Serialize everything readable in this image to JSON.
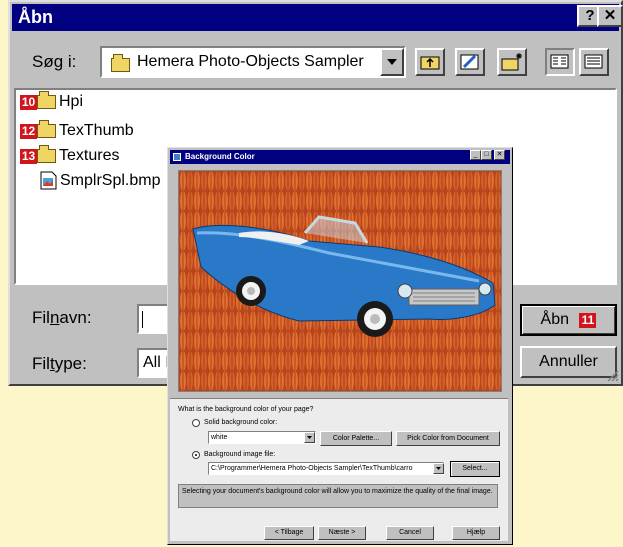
{
  "open_dialog": {
    "title": "Åbn",
    "title_buttons": {
      "help": "?",
      "close": "✕"
    },
    "look_in": {
      "label": "Søg i:",
      "value": "Hemera Photo-Objects Sampler"
    },
    "files": [
      {
        "badge": "10",
        "name": "Hpi",
        "type": "folder"
      },
      {
        "badge": "12",
        "name": "TexThumb",
        "type": "folder"
      },
      {
        "badge": "13",
        "name": "Textures",
        "type": "folder"
      },
      {
        "badge": "",
        "name": "SmplrSpl.bmp",
        "type": "bitmap"
      }
    ],
    "filename": {
      "label": "Filnavn:",
      "value": ""
    },
    "filetype": {
      "label": "Filtype:",
      "value": "All I"
    },
    "open_button": {
      "label": "Åbn",
      "badge": "11"
    },
    "cancel_button": "Annuller"
  },
  "bg_dialog": {
    "title": "Background Color",
    "question": "What is the background color of your page?",
    "solid": {
      "label": "Solid background color:",
      "value": "white",
      "palette_button": "Color Palette...",
      "pick_button": "Pick Color from Document"
    },
    "image": {
      "label": "Background image file:",
      "value": "C:\\Programmer\\Hemera Photo-Objects Sampler\\TexThumb\\carro",
      "select_button": "Select..."
    },
    "info": "Selecting your document's background color will allow you to maximize the quality of the final image.",
    "buttons": {
      "back": "< Tilbage",
      "next": "Næste >",
      "cancel": "Cancel",
      "help": "Hjælp"
    }
  },
  "colors": {
    "title_bar": "#000080",
    "dialog_face": "#c0c0c0",
    "page_bg": "#fdf6c8",
    "badge": "#d2141c",
    "car": "#2a78c8"
  }
}
